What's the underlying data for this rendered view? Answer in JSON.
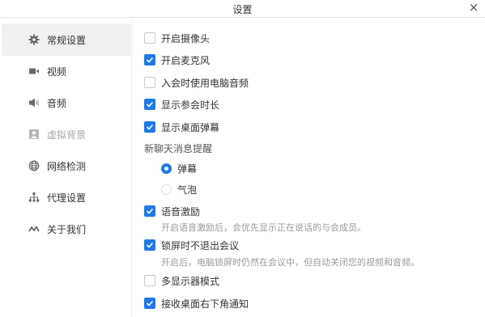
{
  "window": {
    "title": "设置",
    "close_glyph": "×"
  },
  "sidebar": {
    "items": [
      {
        "label": "常规设置",
        "icon": "gear-icon",
        "active": true
      },
      {
        "label": "视频",
        "icon": "video-camera-icon"
      },
      {
        "label": "音频",
        "icon": "speaker-icon"
      },
      {
        "label": "虚拟背景",
        "icon": "portrait-icon",
        "disabled": true
      },
      {
        "label": "网络检测",
        "icon": "globe-icon"
      },
      {
        "label": "代理设置",
        "icon": "network-tree-icon"
      },
      {
        "label": "关于我们",
        "icon": "logo-icon"
      }
    ]
  },
  "general": {
    "open_camera": {
      "label": "开启摄像头",
      "checked": false
    },
    "open_mic": {
      "label": "开启麦克风",
      "checked": true
    },
    "use_pc_audio": {
      "label": "入会时使用电脑音频",
      "checked": false
    },
    "show_duration": {
      "label": "显示参会时长",
      "checked": true
    },
    "show_danmaku": {
      "label": "显示桌面弹幕",
      "checked": true
    },
    "chat_reminder": {
      "label": "新聊天消息提醒",
      "options": [
        {
          "label": "弹幕",
          "selected": true
        },
        {
          "label": "气泡",
          "selected": false
        }
      ]
    },
    "voice_incentive": {
      "label": "语音激励",
      "checked": true,
      "desc": "开启语音激励后，会优先显示正在说话的与会成员。"
    },
    "lock_no_exit": {
      "label": "锁屏时不退出会议",
      "checked": true,
      "desc": "开启后，电脑锁屏时仍然在会议中，但自动关闭您的视频和音频。"
    },
    "multi_display": {
      "label": "多显示器模式",
      "checked": false
    },
    "desktop_notice": {
      "label": "接收桌面右下角通知",
      "checked": true
    }
  },
  "colors": {
    "accent": "#1f78e6",
    "disabled_text": "#a8a8a8",
    "desc_text": "#9a9a9a"
  }
}
